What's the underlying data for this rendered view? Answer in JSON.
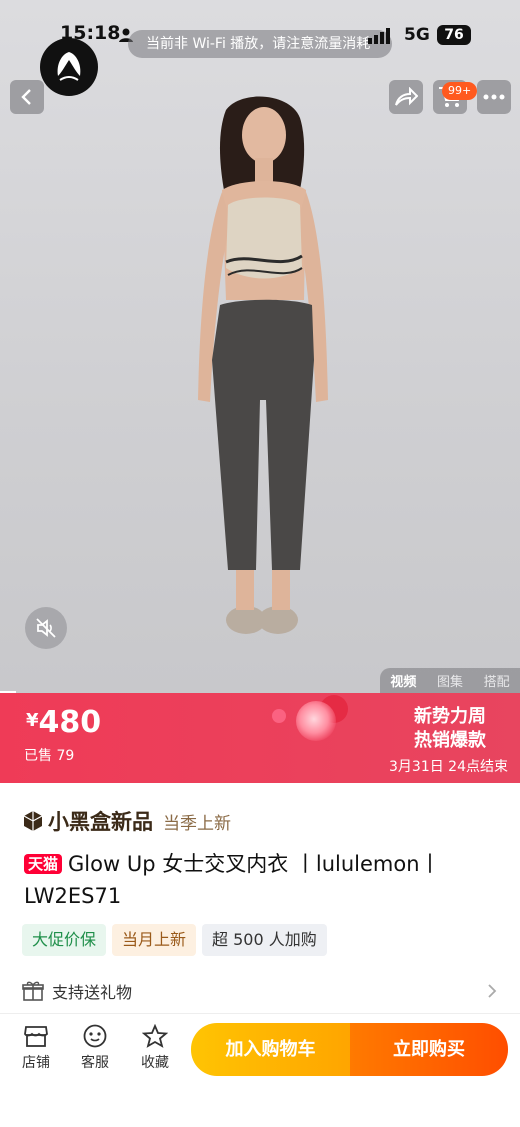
{
  "status_bar": {
    "time": "15:18",
    "toast": "当前非 Wi-Fi 播放，请注意流量消耗",
    "network": "5G",
    "battery": "76"
  },
  "header": {
    "cart_badge": "99+"
  },
  "media": {
    "tabs": [
      "视频",
      "图集",
      "搭配"
    ],
    "active_tab": "视频"
  },
  "price_banner": {
    "currency": "¥",
    "price": "480",
    "sold": "已售 79",
    "promo_line1": "新势力周",
    "promo_line2": "热销爆款",
    "promo_end": "3月31日 24点结束"
  },
  "product": {
    "brand_name": "小黑盒新品",
    "brand_sub": "当季上新",
    "platform_badge": "天猫",
    "title": "Glow Up 女士交叉内衣 丨lululemon丨LW2ES71",
    "tags": [
      "大促价保",
      "当月上新",
      "超 500 人加购"
    ],
    "gift": "支持送礼物"
  },
  "bottom_bar": {
    "store": "店铺",
    "service": "客服",
    "favorite": "收藏",
    "add_to_cart": "加入购物车",
    "buy_now": "立即购买"
  },
  "colors": {
    "banner": "#ef3b57",
    "cart_button": "#ffb300",
    "buy_button": "#ff5a00",
    "tmall": "#ff0036"
  }
}
